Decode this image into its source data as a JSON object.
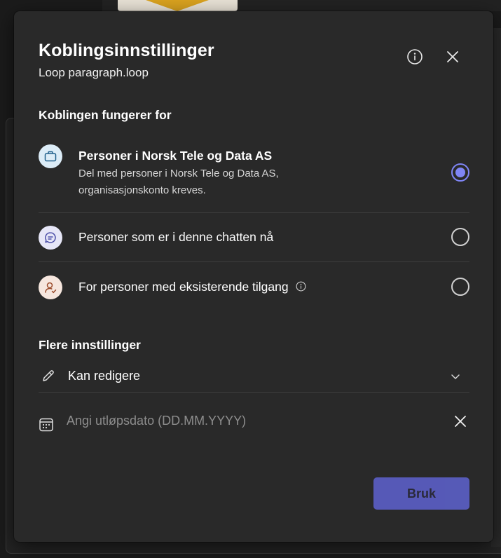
{
  "dialog": {
    "title": "Koblingsinnstillinger",
    "subtitle": "Loop paragraph.loop",
    "info_icon": "info-icon",
    "close_icon": "close-icon"
  },
  "link_works_for": {
    "heading": "Koblingen fungerer for",
    "options": [
      {
        "icon": "briefcase-icon",
        "label": "Personer i Norsk Tele og Data AS",
        "description_line1": "Del med personer i Norsk Tele og Data AS,",
        "description_line2": "organisasjonskonto kreves.",
        "selected": true
      },
      {
        "icon": "chat-icon",
        "label": "Personer som er i denne chatten nå",
        "selected": false
      },
      {
        "icon": "person-access-icon",
        "label": "For personer med eksisterende tilgang",
        "has_info": true,
        "selected": false
      }
    ]
  },
  "more_settings": {
    "heading": "Flere innstillinger",
    "permission": {
      "icon": "pencil-icon",
      "value": "Kan redigere"
    },
    "expiry": {
      "icon": "calendar-icon",
      "placeholder": "Angi utløpsdato (DD.MM.YYYY)"
    }
  },
  "footer": {
    "apply_label": "Bruk"
  },
  "colors": {
    "dialog_bg": "#292929",
    "accent": "#7f85f5",
    "button_bg": "#5b5fc7",
    "icon_org_bg": "#dcecf7",
    "icon_chat_bg": "#e6e6f7",
    "icon_person_bg": "#f6e6de"
  }
}
